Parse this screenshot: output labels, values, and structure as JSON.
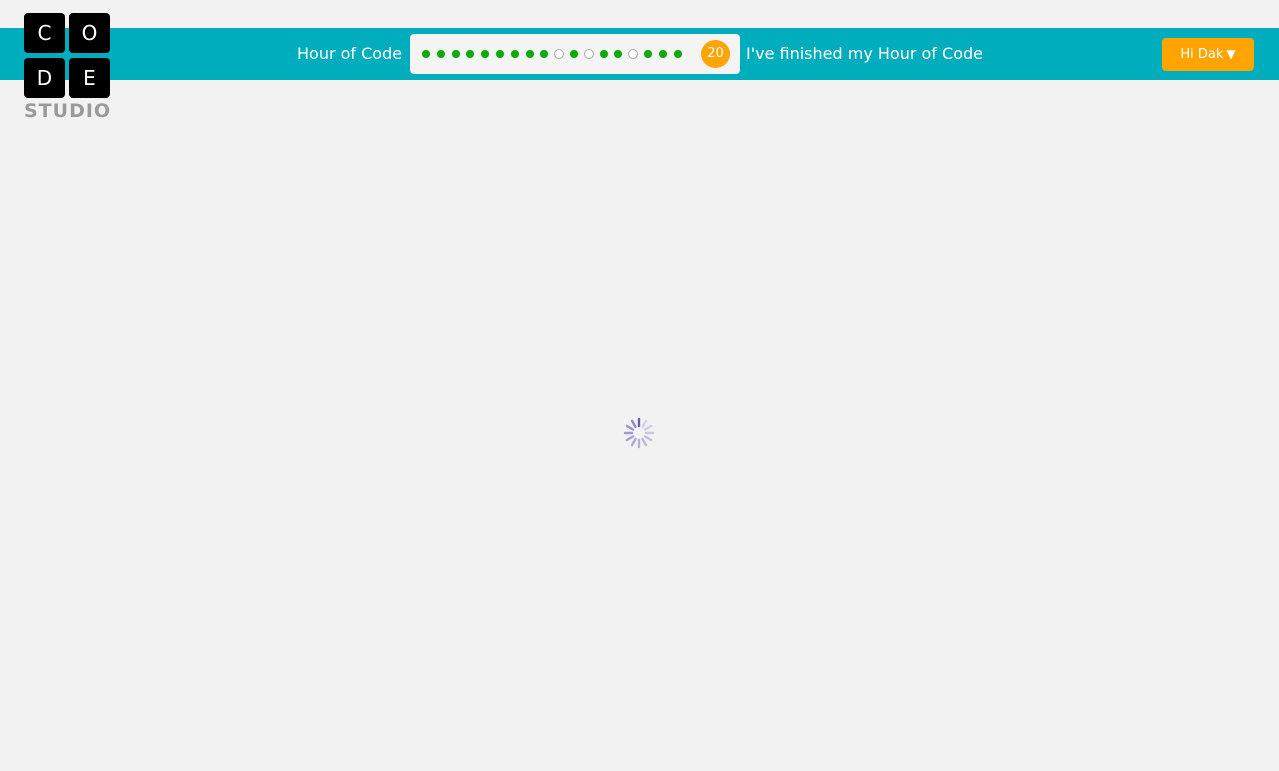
{
  "logo": {
    "letters": [
      "C",
      "O",
      "D",
      "E"
    ],
    "subtitle": "STUDIO"
  },
  "header": {
    "course_title": "Hour of Code",
    "finished_link": "I've finished my Hour of Code",
    "user_menu_label": "Hi Dak",
    "user_menu_arrow": "▼"
  },
  "progress": {
    "levels": [
      "done",
      "done",
      "done",
      "done",
      "done",
      "done",
      "done",
      "done",
      "done",
      "todo",
      "done",
      "todo",
      "done",
      "done",
      "todo",
      "done",
      "done",
      "done"
    ],
    "current_level": "20"
  },
  "status": {
    "spinner_icon": "loading-spinner-icon"
  },
  "colors": {
    "header_bg": "#00adbc",
    "accent": "#ffa400",
    "level_done": "#0ea70e",
    "page_bg": "#f2f2f2"
  }
}
